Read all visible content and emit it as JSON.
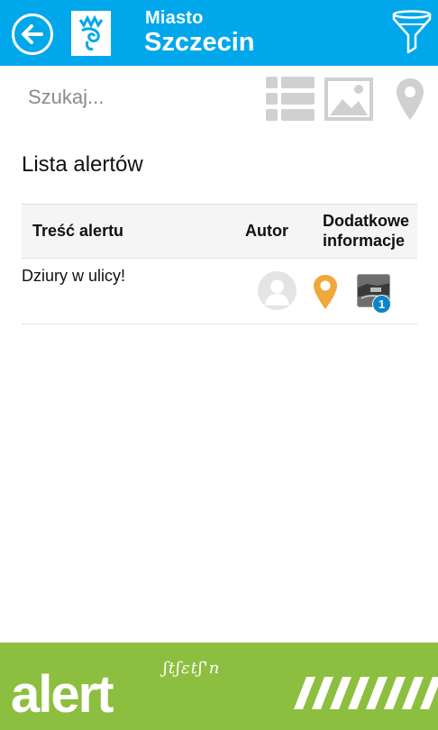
{
  "header": {
    "city_small": "Miasto",
    "city_big": "Szczecin",
    "back_icon": "back-arrow-icon",
    "logo_icon": "city-logo-icon",
    "filter_icon": "filter-icon",
    "bg_color": "#00a7ea"
  },
  "search": {
    "placeholder": "Szukaj..."
  },
  "view_switcher": [
    "list-view-icon",
    "gallery-view-icon",
    "map-view-icon"
  ],
  "page_title": "Lista alertów",
  "table": {
    "columns": [
      "Treść alertu",
      "Autor",
      "Dodatkowe informacje"
    ],
    "rows": [
      {
        "content": "Dziury w ulicy!",
        "author_icon": "avatar-icon",
        "location_icon": "location-pin-icon",
        "photo_count": "1"
      }
    ]
  },
  "footer": {
    "brand": "alert",
    "brand_sub": "ʃtʃɛtʃ'n",
    "bg_color": "#8cbf3f"
  }
}
